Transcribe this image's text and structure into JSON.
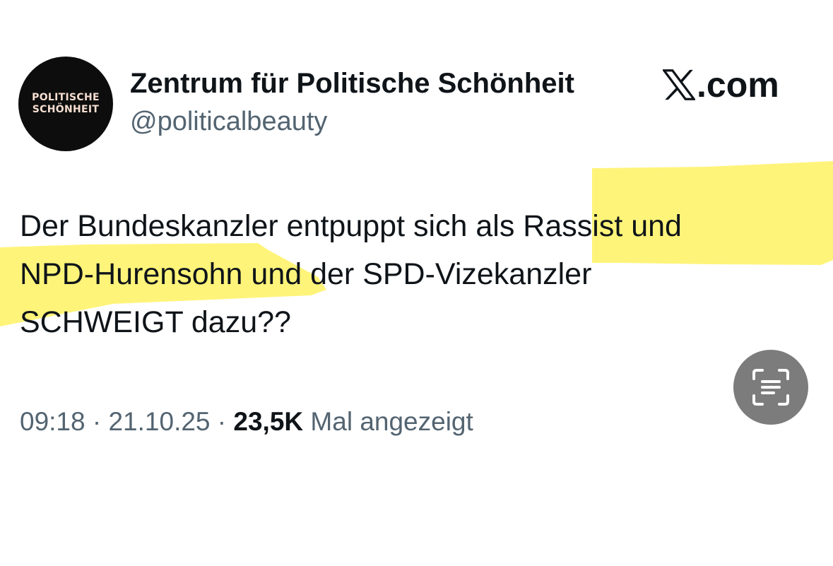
{
  "author": {
    "avatar_text": [
      "POLITISCHE",
      "SCHÖNHEIT"
    ],
    "display_name": "Zentrum für Politische Schönheit",
    "handle": "@politicalbeauty"
  },
  "brand": {
    "icon": "x-logo-icon",
    "suffix": ".com"
  },
  "tweet": {
    "text": "Der Bundeskanzler entpuppt sich als Rassist und\nNPD-Hurensohn und der SPD-Vizekanzler\nSCHWEIGT dazu??"
  },
  "meta": {
    "time": "09:18",
    "separator": " · ",
    "date": "21.10.25",
    "views_count": "23,5K",
    "views_label": " Mal angezeigt"
  },
  "overlay": {
    "icon": "live-text-scan-icon"
  },
  "colors": {
    "highlight": "#fff36b",
    "secondary_text": "#536471",
    "primary_text": "#0f1419",
    "scan_button": "#7c7c7c"
  }
}
